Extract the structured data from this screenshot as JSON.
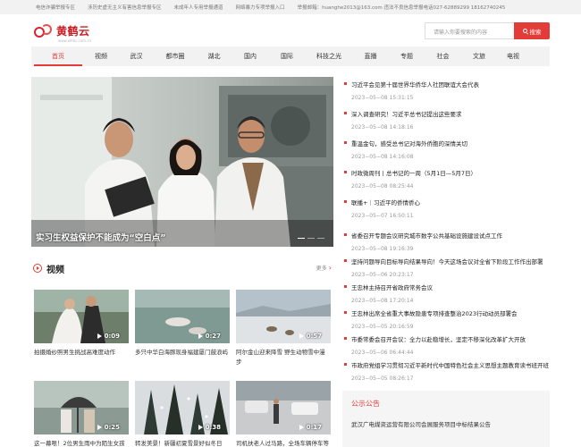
{
  "topbar": {
    "links": [
      "电信诈骗举报专区",
      "涉历史虚无主义有害信息举报专区",
      "未成年人专用举报通道",
      "网络暴力专项举报入口",
      "举报邮箱：huanghe2013@163.com 违法不良信息举报电话027-62889299 18162740245"
    ]
  },
  "logo": {
    "name": "黄鹤云",
    "sub": "www.whbc.com.cn"
  },
  "search": {
    "placeholder": "请输入你要搜索的内容",
    "button": "搜索"
  },
  "nav": [
    "首页",
    "视频",
    "武汉",
    "都市圈",
    "湖北",
    "国内",
    "国际",
    "科技之光",
    "直播",
    "专题",
    "社会",
    "文旅",
    "电视"
  ],
  "hero": {
    "caption": "实习生权益保护不能成为“空白点”"
  },
  "video_section": {
    "title": "视频",
    "more": "更多"
  },
  "videos": [
    {
      "duration": "0:09",
      "title": "拍摄婚纱照男生挑战高难度动作"
    },
    {
      "duration": "0:27",
      "title": "多只中华白海豚现身福建厦门鼓浪屿"
    },
    {
      "duration": "0:57",
      "title": "阿尔金山迎来降雪 野生动物雪中漫步"
    },
    {
      "duration": "0:25",
      "title": "这一幕哏！2位男生雨中为陌生女孩撑伞"
    },
    {
      "duration": "0:38",
      "title": "转发美景！新疆初夏雪景好似冬日"
    },
    {
      "duration": "0:17",
      "title": "司机扶老人过马路，全场车辆停车等候"
    }
  ],
  "news": [
    {
      "title": "习近平会见第十届世界华侨华人社团联谊大会代表",
      "date": "2023−05−08 15:31:15"
    },
    {
      "title": "深入调查研究！习近平总书记提出这些要求",
      "date": "2023−05−08 14:18:16"
    },
    {
      "title": "重温金句，感受总书记对海外侨胞的深情关切",
      "date": "2023−05−08 14:16:08"
    },
    {
      "title": "时政微周刊丨总书记的一周（5月1日—5月7日）",
      "date": "2023−05−08 08:25:44"
    },
    {
      "title": "联播+｜习近平的侨情侨心",
      "date": "2023−05−07 16:50:11"
    },
    {
      "title": "省委召开专题会议研究城市数字公共基础设施建设试点工作",
      "date": "2023−05−08 19:16:39"
    },
    {
      "title": "坚持问题导向目标导向结果导向！今天这场会议对全省下阶段工作作出部署",
      "date": "2023−05−06 20:23:17"
    },
    {
      "title": "王忠林主持召开省政府常务会议",
      "date": "2023−05−08 17:20:14"
    },
    {
      "title": "王忠林出席全省重大事故隐患专项排查整治2023行动动员部署会",
      "date": "2023−05−05 20:16:59"
    },
    {
      "title": "市委常委会召开会议：全力以赴稳增长，坚定不移深化改革扩大开放",
      "date": "2023−05−06 06:44:44"
    },
    {
      "title": "市政府党组学习贯彻习近平新时代中国特色社会主义思想主题教育读书班开班",
      "date": "2023−05−05 08:26:17"
    }
  ],
  "notice": {
    "title": "公示公告",
    "item": "武汉广电媒资运营有限公司会展服务项目中标结果公告"
  },
  "colors": {
    "accent": "#e23b38",
    "brand": "#c81e24"
  }
}
